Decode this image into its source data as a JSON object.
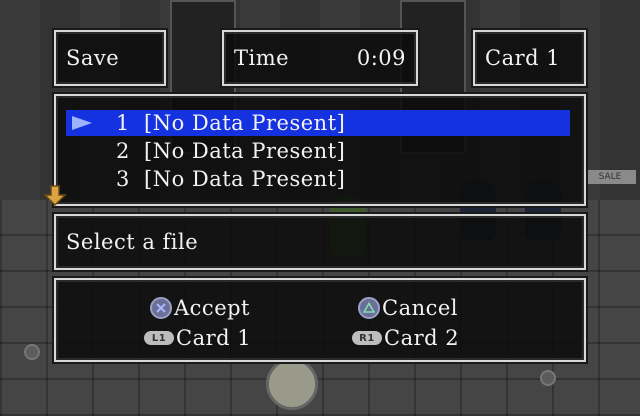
{
  "header": {
    "mode_label": "Save",
    "time_label": "Time",
    "time_value": "0:09",
    "card_label": "Card 1"
  },
  "files": [
    {
      "number": "1",
      "status": "[No Data Present]",
      "selected": true
    },
    {
      "number": "2",
      "status": "[No Data Present]",
      "selected": false
    },
    {
      "number": "3",
      "status": "[No Data Present]",
      "selected": false
    }
  ],
  "message": "Select a file",
  "controls": {
    "accept_label": "Accept",
    "cancel_label": "Cancel",
    "l1_label": "Card 1",
    "r1_label": "Card 2",
    "l1_badge": "L1",
    "r1_badge": "R1"
  },
  "scene": {
    "sign_text": "SALE"
  },
  "colors": {
    "selection": "#1432e0",
    "cursor": "#9fb2ff",
    "panel_border": "#d8d8d8",
    "scroll_arrow": "#d9a441"
  },
  "icons": [
    "cursor-arrow-icon",
    "scroll-down-arrow-icon",
    "cross-button-icon",
    "triangle-button-icon",
    "l1-button-icon",
    "r1-button-icon"
  ]
}
